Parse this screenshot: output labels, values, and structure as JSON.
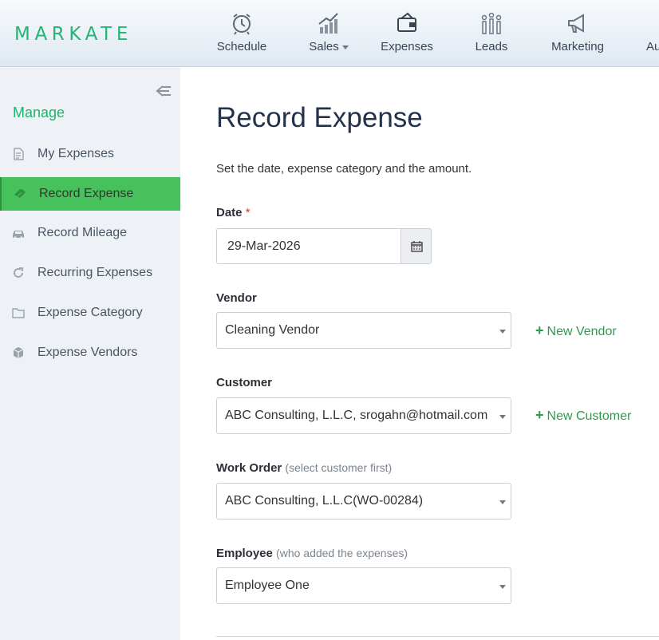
{
  "brand": {
    "logo": "MARKATE"
  },
  "nav": [
    {
      "id": "schedule",
      "label": "Schedule",
      "icon": "alarm-clock-icon"
    },
    {
      "id": "sales",
      "label": "Sales",
      "icon": "bar-growth-icon",
      "has_dropdown": true
    },
    {
      "id": "expenses",
      "label": "Expenses",
      "icon": "wallet-icon"
    },
    {
      "id": "leads",
      "label": "Leads",
      "icon": "people-bars-icon"
    },
    {
      "id": "marketing",
      "label": "Marketing",
      "icon": "megaphone-icon"
    },
    {
      "id": "au",
      "label": "Au"
    }
  ],
  "sidebar": {
    "title": "Manage",
    "items": [
      {
        "label": "My Expenses",
        "icon": "document-icon"
      },
      {
        "label": "Record Expense",
        "icon": "money-icon",
        "active": true
      },
      {
        "label": "Record Mileage",
        "icon": "car-icon"
      },
      {
        "label": "Recurring Expenses",
        "icon": "refresh-icon"
      },
      {
        "label": "Expense Category",
        "icon": "folder-icon"
      },
      {
        "label": "Expense Vendors",
        "icon": "cube-icon"
      }
    ]
  },
  "main": {
    "title": "Record Expense",
    "subtitle": "Set the date, expense category and the amount.",
    "date": {
      "label": "Date",
      "required_mark": "*",
      "value": "29-Mar-2026"
    },
    "vendor": {
      "label": "Vendor",
      "value": "Cleaning Vendor",
      "new_link": "New Vendor"
    },
    "customer": {
      "label": "Customer",
      "value": "ABC Consulting, L.L.C, srogahn@hotmail.com",
      "new_link": "New Customer"
    },
    "work_order": {
      "label": "Work Order",
      "hint": "(select customer first)",
      "value": "ABC Consulting, L.L.C(WO-00284)"
    },
    "employee": {
      "label": "Employee",
      "hint": "(who added the expenses)",
      "value": "Employee One"
    }
  },
  "colors": {
    "brand_green": "#22b573",
    "active_green": "#47c15b",
    "link_green": "#2f9a4d"
  }
}
